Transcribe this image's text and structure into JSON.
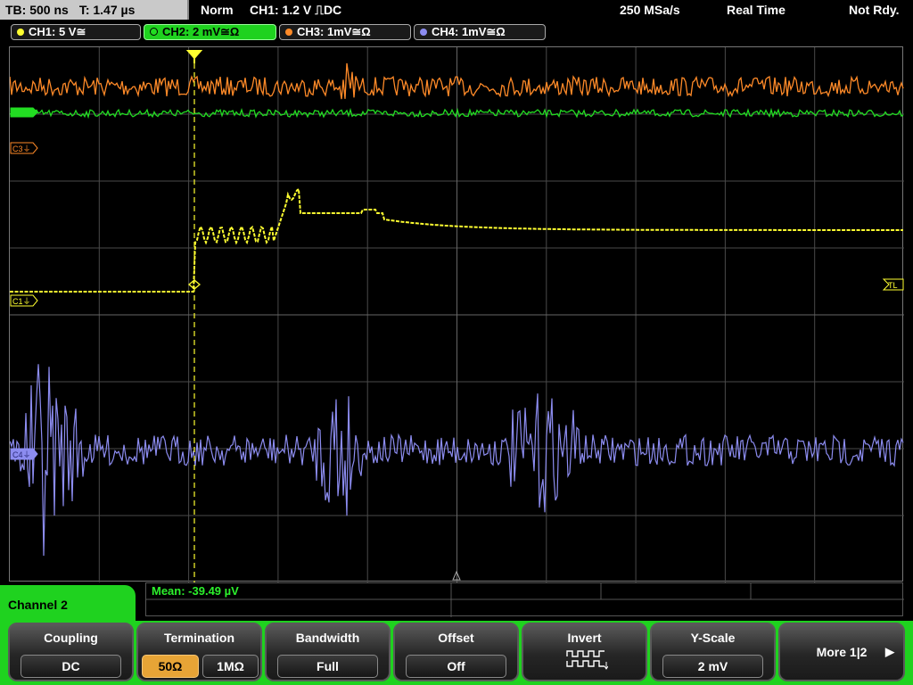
{
  "status_bar": {
    "timebase": "TB: 500 ns",
    "trigger_time": "T: 1.47 µs",
    "trigger_mode": "Norm",
    "trigger_info": "CH1: 1.2 V ⎍DC",
    "sample_rate": "250 MSa/s",
    "acq_mode": "Real Time",
    "status": "Not Rdy."
  },
  "channels": [
    {
      "label": "CH1: 5 V≅",
      "color": "#ffff30"
    },
    {
      "label": "CH2: 2 mV≅Ω",
      "color": "#22dd22"
    },
    {
      "label": "CH3: 1mV≅Ω",
      "color": "#ff8a28"
    },
    {
      "label": "CH4: 1mV≅Ω",
      "color": "#8c8cf0"
    }
  ],
  "markers": {
    "c3": "C3⏚",
    "c1": "C1⏚",
    "c4": "C4⏚",
    "trigger_level": "TL"
  },
  "measurement": {
    "text": "Mean: -39.49 µV"
  },
  "menu": {
    "title": "Channel 2",
    "softkeys": {
      "coupling": {
        "label": "Coupling",
        "value": "DC"
      },
      "termination": {
        "label": "Termination",
        "options": [
          "50Ω",
          "1MΩ"
        ],
        "selected": "50Ω"
      },
      "bandwidth": {
        "label": "Bandwidth",
        "value": "Full"
      },
      "offset": {
        "label": "Offset",
        "value": "Off"
      },
      "invert": {
        "label": "Invert",
        "icon": "invert-icon"
      },
      "yscale": {
        "label": "Y-Scale",
        "value": "2 mV"
      },
      "more": {
        "label": "More 1|2",
        "icon": "arrow-right-icon"
      }
    }
  },
  "colors": {
    "grid": "#4a4a4a",
    "accent": "#1fd21f",
    "selected": "#e7a436"
  }
}
